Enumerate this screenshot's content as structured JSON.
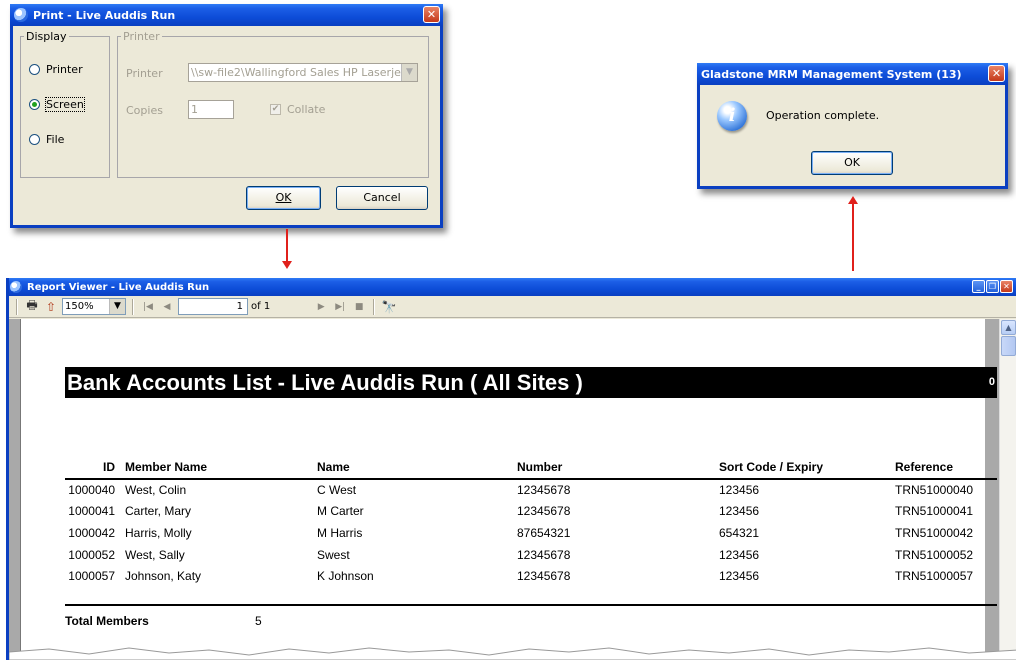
{
  "print_dialog": {
    "title": "Print - Live Auddis Run",
    "display_group": "Display",
    "printer_group": "Printer",
    "options": [
      {
        "label": "Printer",
        "selected": false
      },
      {
        "label": "Screen",
        "selected": true
      },
      {
        "label": "File",
        "selected": false
      }
    ],
    "printer_label": "Printer",
    "printer_value": "\\\\sw-file2\\Wallingford Sales HP Laserje",
    "copies_label": "Copies",
    "copies_value": "1",
    "collate_label": "Collate",
    "ok_label": "OK",
    "cancel_label": "Cancel",
    "close_glyph": "✕"
  },
  "message_box": {
    "title": "Gladstone MRM Management System (13)",
    "message": "Operation complete.",
    "ok_label": "OK",
    "icon_glyph": "i",
    "close_glyph": "✕"
  },
  "report_viewer": {
    "title": "Report Viewer - Live Auddis Run",
    "zoom": "150%",
    "page": "1",
    "of_pages": "of 1",
    "report_title": "Bank Accounts List  - Live Auddis Run ( All Sites )",
    "page_number": "0",
    "columns": [
      "ID",
      "Member Name",
      "Name",
      "Number",
      "Sort Code / Expiry",
      "Reference"
    ],
    "rows": [
      [
        "1000040",
        "West, Colin",
        "C West",
        "12345678",
        "123456",
        "TRN51000040"
      ],
      [
        "1000041",
        "Carter, Mary",
        "M Carter",
        "12345678",
        "123456",
        "TRN51000041"
      ],
      [
        "1000042",
        "Harris, Molly",
        "M Harris",
        "87654321",
        "654321",
        "TRN51000042"
      ],
      [
        "1000052",
        "West, Sally",
        "Swest",
        "12345678",
        "123456",
        "TRN51000052"
      ],
      [
        "1000057",
        "Johnson, Katy",
        "K Johnson",
        "12345678",
        "123456",
        "TRN51000057"
      ]
    ],
    "total_label": "Total Members",
    "total_value": "5"
  },
  "colors": {
    "title_bar": "#0a3fc1",
    "dialog_bg": "#ece9d8",
    "arrow": "#e0201b",
    "radio_dot": "#21a121"
  },
  "icons": [
    "app-icon",
    "close-icon",
    "info-icon",
    "print-icon",
    "export-icon",
    "first-page-icon",
    "prev-page-icon",
    "next-page-icon",
    "last-page-icon",
    "stop-icon",
    "find-icon"
  ]
}
